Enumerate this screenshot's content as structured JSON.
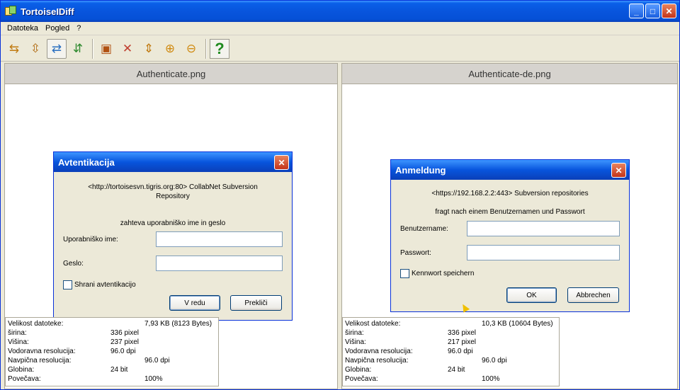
{
  "window": {
    "title": "TortoiseIDiff",
    "minimize": "_",
    "maximize": "□",
    "close": "✕"
  },
  "menu": [
    "Datoteka",
    "Pogled",
    "?"
  ],
  "toolbar": {
    "help": "?"
  },
  "left": {
    "header": "Authenticate.png",
    "dialog": {
      "title": "Avtentikacija",
      "close": "✕",
      "line1": "<http://tortoisesvn.tigris.org:80> CollabNet Subversion",
      "line2": "Repository",
      "line3": "zahteva uporabniško ime in geslo",
      "user_label": "Uporabniško ime:",
      "pass_label": "Geslo:",
      "save_label": "Shrani avtentikacijo",
      "ok": "V redu",
      "cancel": "Prekliči"
    },
    "info": [
      {
        "k": "Velikost datoteke:",
        "v": "7,93 KB (8123 Bytes)"
      },
      {
        "k": "širina:",
        "v": "336 pixel"
      },
      {
        "k": "Višina:",
        "v": "237 pixel"
      },
      {
        "k": "Vodoravna resolucija:",
        "v": "96.0 dpi"
      },
      {
        "k": "Navpična resolucija:",
        "v": "96.0 dpi"
      },
      {
        "k": "Globina:",
        "v": "24 bit"
      },
      {
        "k": "Povečava:",
        "v": "100%"
      }
    ]
  },
  "right": {
    "header": "Authenticate-de.png",
    "dialog": {
      "title": "Anmeldung",
      "close": "✕",
      "line1": "<https://192.168.2.2:443> Subversion repositories",
      "line2": "fragt nach einem Benutzernamen und Passwort",
      "user_label": "Benutzername:",
      "pass_label": "Passwort:",
      "save_label": "Kennwort speichern",
      "ok": "OK",
      "cancel": "Abbrechen"
    },
    "info": [
      {
        "k": "Velikost datoteke:",
        "v": "10,3 KB (10604 Bytes)"
      },
      {
        "k": "širina:",
        "v": "336 pixel"
      },
      {
        "k": "Višina:",
        "v": "217 pixel"
      },
      {
        "k": "Vodoravna resolucija:",
        "v": "96.0 dpi"
      },
      {
        "k": "Navpična resolucija:",
        "v": "96.0 dpi"
      },
      {
        "k": "Globina:",
        "v": "24 bit"
      },
      {
        "k": "Povečava:",
        "v": "100%"
      }
    ]
  }
}
